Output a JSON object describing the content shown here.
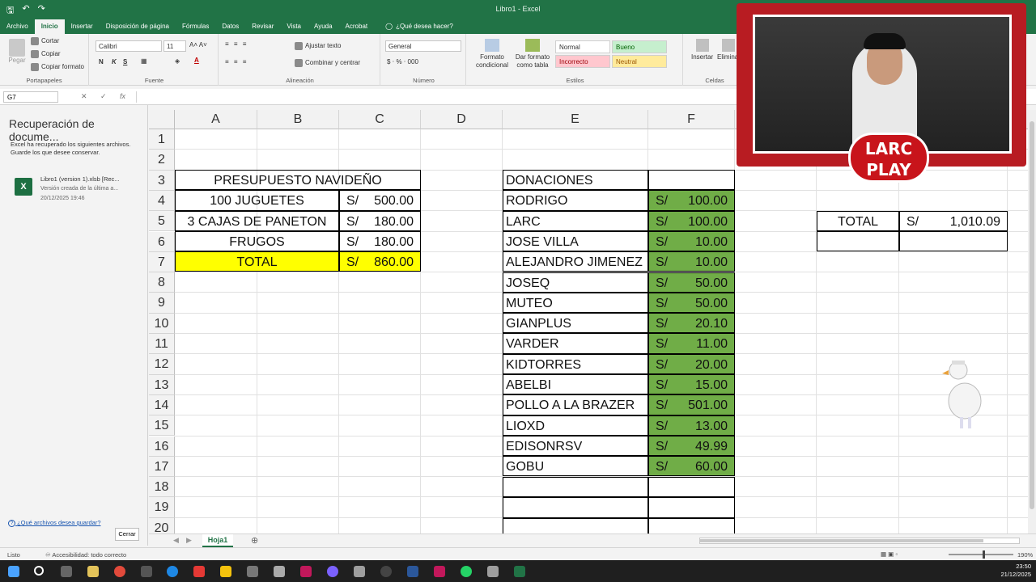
{
  "titlebar": {
    "title": "Libro1  -  Excel"
  },
  "tabs": [
    "Archivo",
    "Inicio",
    "Insertar",
    "Disposición de página",
    "Fórmulas",
    "Datos",
    "Revisar",
    "Vista",
    "Ayuda",
    "Acrobat"
  ],
  "tell_me": "¿Qué desea hacer?",
  "ribbon": {
    "clipboard": {
      "paste": "Pegar",
      "cut": "Cortar",
      "copy": "Copiar",
      "format_painter": "Copiar formato",
      "label": "Portapapeles"
    },
    "font": {
      "name": "Calibri",
      "size": "11",
      "label": "Fuente",
      "bold": "N",
      "italic": "K",
      "underline": "S"
    },
    "alignment": {
      "wrap": "Ajustar texto",
      "merge": "Combinar y centrar",
      "label": "Alineación"
    },
    "number": {
      "format": "General",
      "label": "Número"
    },
    "styles": {
      "cond_format": "Formato condicional",
      "format_table": "Dar formato como tabla",
      "normal": "Normal",
      "good": "Bueno",
      "bad": "Incorrecto",
      "neutral": "Neutral",
      "label": "Estilos"
    },
    "cells": {
      "insert": "Insertar",
      "delete": "Eliminar",
      "label": "Celdas"
    }
  },
  "formula_bar": {
    "name_box": "G7",
    "fx": "fx",
    "content": ""
  },
  "recovery": {
    "title": "Recuperación de docume...",
    "description": "Excel ha recuperado los siguientes archivos. Guarde los que desee conservar.",
    "file_name": "Libro1 (version 1).xlsb  [Rec...",
    "file_desc": "Versión creada de la última a...",
    "file_date": "20/12/2025 19:46",
    "link": "¿Qué archivos desea guardar?",
    "close": "Cerrar"
  },
  "columns": [
    "A",
    "B",
    "C",
    "D",
    "E",
    "F"
  ],
  "rows": [
    "1",
    "2",
    "3",
    "4",
    "5",
    "6",
    "7",
    "8",
    "9",
    "10",
    "11",
    "12",
    "13",
    "14",
    "15",
    "16",
    "17",
    "18",
    "19",
    "20"
  ],
  "budget": {
    "title": "PRESUPUESTO NAVIDEÑO",
    "items": [
      {
        "label": "100 JUGUETES",
        "currency": "S/",
        "amount": "500.00"
      },
      {
        "label": "3 CAJAS DE PANETON",
        "currency": "S/",
        "amount": "180.00"
      },
      {
        "label": "FRUGOS",
        "currency": "S/",
        "amount": "180.00"
      }
    ],
    "total_label": "TOTAL",
    "total_currency": "S/",
    "total_amount": "860.00"
  },
  "donations": {
    "header": "DONACIONES",
    "items": [
      {
        "name": "RODRIGO",
        "currency": "S/",
        "amount": "100.00"
      },
      {
        "name": "LARC",
        "currency": "S/",
        "amount": "100.00"
      },
      {
        "name": "JOSE VILLA",
        "currency": "S/",
        "amount": "10.00"
      },
      {
        "name": "ALEJANDRO JIMENEZ",
        "currency": "S/",
        "amount": "10.00"
      },
      {
        "name": "JOSEQ",
        "currency": "S/",
        "amount": "50.00"
      },
      {
        "name": "MUTEO",
        "currency": "S/",
        "amount": "50.00"
      },
      {
        "name": "GIANPLUS",
        "currency": "S/",
        "amount": "20.10"
      },
      {
        "name": "VARDER",
        "currency": "S/",
        "amount": "11.00"
      },
      {
        "name": "KIDTORRES",
        "currency": "S/",
        "amount": "20.00"
      },
      {
        "name": "ABELBI",
        "currency": "S/",
        "amount": "15.00"
      },
      {
        "name": "POLLO A LA BRAZER",
        "currency": "S/",
        "amount": "501.00"
      },
      {
        "name": "LIOXD",
        "currency": "S/",
        "amount": "13.00"
      },
      {
        "name": "EDISONRSV",
        "currency": "S/",
        "amount": "49.99"
      },
      {
        "name": "GOBU",
        "currency": "S/",
        "amount": "60.00"
      }
    ]
  },
  "donation_total": {
    "label": "TOTAL",
    "currency": "S/",
    "amount": "1,010.09"
  },
  "sheet": {
    "tab": "Hoja1"
  },
  "status": {
    "ready": "Listo",
    "accessibility": "Accesibilidad: todo correcto",
    "zoom": "190%"
  },
  "clock": {
    "time": "23:50",
    "date": "21/12/2025"
  },
  "overlay": {
    "logo_line1": "LARC",
    "logo_line2": "PLAY"
  },
  "colors": {
    "excel_green": "#217346",
    "cell_green": "#70ad47",
    "cell_yellow": "#ffff00"
  }
}
